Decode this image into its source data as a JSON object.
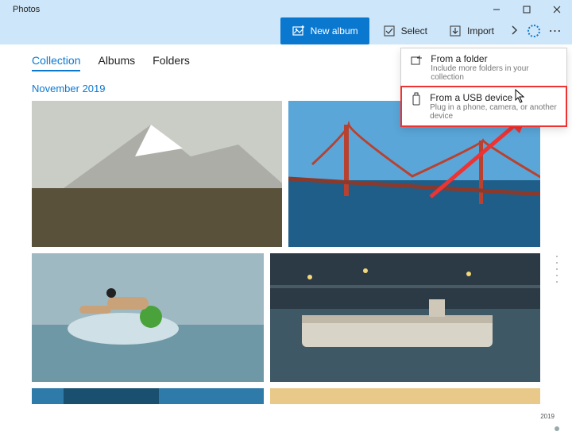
{
  "window": {
    "title": "Photos"
  },
  "toolbar": {
    "new_album": "New album",
    "select": "Select",
    "import": "Import"
  },
  "tabs": {
    "collection": "Collection",
    "albums": "Albums",
    "folders": "Folders",
    "active": "collection"
  },
  "date_header": "November 2019",
  "flyout": {
    "folder": {
      "title": "From a folder",
      "sub": "Include more folders in your collection"
    },
    "usb": {
      "title": "From a USB device",
      "sub": "Plug in a phone, camera, or another device"
    }
  },
  "timeline": {
    "year": "2019"
  },
  "thumbnails": [
    {
      "name": "snowy-mountain"
    },
    {
      "name": "golden-gate-bridge"
    },
    {
      "name": "swimmer-freestyle"
    },
    {
      "name": "river-boat-evening"
    },
    {
      "name": "underwater-swimmer"
    },
    {
      "name": "sunset-gradient"
    }
  ]
}
